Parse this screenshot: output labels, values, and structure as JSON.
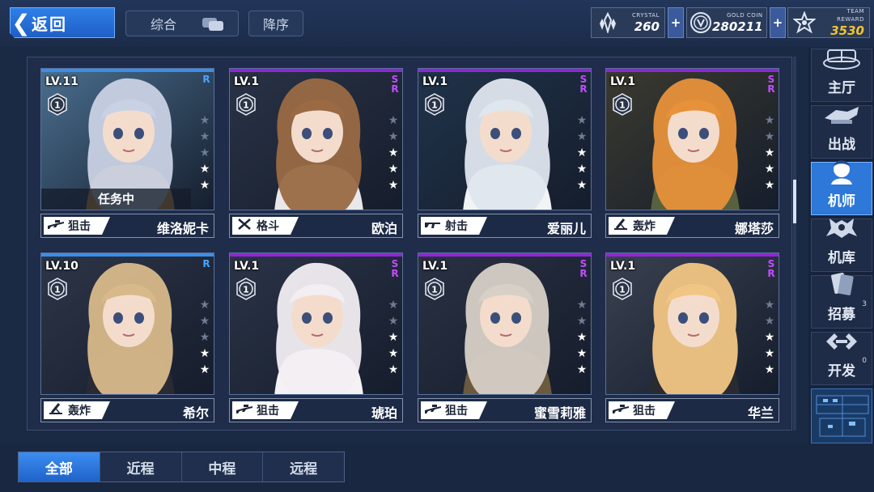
{
  "header": {
    "back_label": "返回",
    "sort_combo_label": "综合",
    "sort_order_label": "降序"
  },
  "resources": {
    "crystal": {
      "caption": "CRYSTAL",
      "value": "260"
    },
    "gold": {
      "caption": "GOLD COIN",
      "value": "280211"
    },
    "reward": {
      "caption": "TEAM REWARD",
      "value": "3530"
    },
    "plus_symbol": "+"
  },
  "cards": [
    {
      "level": "LV.11",
      "rank": "1",
      "rarity": "R",
      "stars_on": 2,
      "stars_total": 5,
      "status": "任务中",
      "class_label": "狙击",
      "class_icon": "sniper-rifle-icon",
      "name": "维洛妮卡",
      "art": {
        "bg": "#4a6f8f",
        "hair": "#c9d2e4",
        "cloth": "#d89a3d"
      }
    },
    {
      "level": "LV.1",
      "rank": "1",
      "rarity": "SR",
      "stars_on": 3,
      "stars_total": 5,
      "status": "",
      "class_label": "格斗",
      "class_icon": "crossed-swords-icon",
      "name": "欧泊",
      "art": {
        "bg": "#2a3346",
        "hair": "#9a6a44",
        "cloth": "#e9e7ea"
      }
    },
    {
      "level": "LV.1",
      "rank": "1",
      "rarity": "SR",
      "stars_on": 3,
      "stars_total": 5,
      "status": "",
      "class_label": "射击",
      "class_icon": "assault-rifle-icon",
      "name": "爱丽儿",
      "art": {
        "bg": "#20334a",
        "hair": "#dfe6ee",
        "cloth": "#f1f3f5"
      }
    },
    {
      "level": "LV.1",
      "rank": "1",
      "rarity": "SR",
      "stars_on": 3,
      "stars_total": 5,
      "status": "",
      "class_label": "轰炸",
      "class_icon": "mortar-icon",
      "name": "娜塔莎",
      "art": {
        "bg": "#3b3a2f",
        "hair": "#e7913a",
        "cloth": "#58603d"
      }
    },
    {
      "level": "LV.10",
      "rank": "1",
      "rarity": "R",
      "stars_on": 2,
      "stars_total": 5,
      "status": "",
      "class_label": "轰炸",
      "class_icon": "mortar-icon",
      "name": "希尔",
      "art": {
        "bg": "#2d3548",
        "hair": "#d8b98a",
        "cloth": "#2a2a33"
      }
    },
    {
      "level": "LV.1",
      "rank": "1",
      "rarity": "SR",
      "stars_on": 3,
      "stars_total": 5,
      "status": "",
      "class_label": "狙击",
      "class_icon": "sniper-rifle-icon",
      "name": "琥珀",
      "art": {
        "bg": "#2b3447",
        "hair": "#f2eef2",
        "cloth": "#f4f2f4"
      }
    },
    {
      "level": "LV.1",
      "rank": "1",
      "rarity": "SR",
      "stars_on": 3,
      "stars_total": 5,
      "status": "",
      "class_label": "狙击",
      "class_icon": "sniper-rifle-icon",
      "name": "蜜雪莉雅",
      "art": {
        "bg": "#2a3143",
        "hair": "#d7d0c7",
        "cloth": "#6b5a3e"
      }
    },
    {
      "level": "LV.1",
      "rank": "1",
      "rarity": "SR",
      "stars_on": 3,
      "stars_total": 5,
      "status": "",
      "class_label": "狙击",
      "class_icon": "sniper-rifle-icon",
      "name": "华兰",
      "art": {
        "bg": "#3a4150",
        "hair": "#f1c684",
        "cloth": "#2a2b30"
      }
    }
  ],
  "sidenav": {
    "items": [
      {
        "label": "主厅",
        "icon": "main-hall-icon",
        "active": false
      },
      {
        "label": "出战",
        "icon": "sortie-icon",
        "active": false
      },
      {
        "label": "机师",
        "icon": "pilot-icon",
        "active": true
      },
      {
        "label": "机库",
        "icon": "hangar-icon",
        "active": false
      },
      {
        "label": "招募",
        "icon": "recruit-icon",
        "active": false,
        "badge": "3"
      },
      {
        "label": "开发",
        "icon": "develop-icon",
        "active": false,
        "badge": "0"
      }
    ]
  },
  "filters": {
    "items": [
      "全部",
      "近程",
      "中程",
      "远程"
    ],
    "active_index": 0
  },
  "colors": {
    "accent_blue": "#2d78d8",
    "rarity_r": "#4aa3ff",
    "rarity_sr": "#c44cff",
    "reward_gold": "#f4c32b"
  }
}
